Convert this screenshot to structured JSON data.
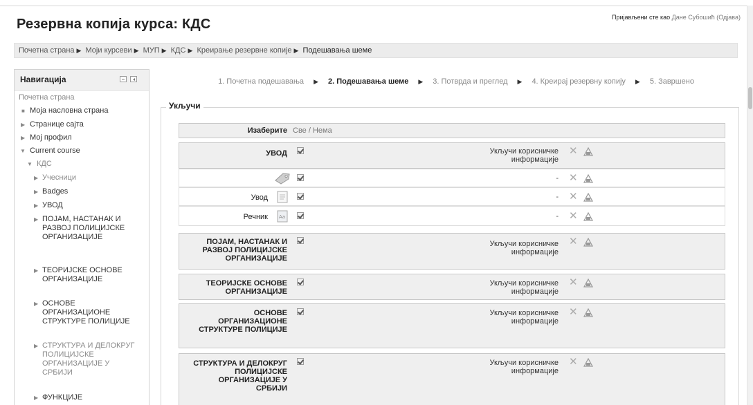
{
  "page": {
    "title": "Резервна копија курса: КДС",
    "login": {
      "prefix": "Пријављени сте као",
      "user": "Дане Субошић",
      "logout": "(Одјава)"
    }
  },
  "breadcrumb": {
    "items": [
      "Почетна страна",
      "Моји курсеви",
      "МУП",
      "КДС",
      "Креирање резервне копије",
      "Подешавања шеме"
    ]
  },
  "navigation": {
    "title": "Навигација",
    "home": "Почетна страна",
    "items": [
      "Моја насловна страна",
      "Странице сајта",
      "Мој профил",
      "Current course",
      "КДС",
      "Учесници",
      "Badges",
      "УВОД"
    ],
    "topics": [
      "ПОЈАМ, НАСТАНАК И РАЗВОЈ ПОЛИЦИЈСКЕ ОРГАНИЗАЦИЈЕ",
      "ТЕОРИЈСКЕ ОСНОВЕ ОРГАНИЗАЦИЈЕ",
      "ОСНОВЕ ОРГАНИЗАЦИОНЕ СТРУКТУРЕ ПОЛИЦИЈЕ",
      "СТРУКТУРА И ДЕЛОКРУГ ПОЛИЦИЈСКЕ ОРГАНИЗАЦИЈЕ У СРБИЈИ",
      "ФУНКЦИЈЕ"
    ]
  },
  "steps": [
    "1. Почетна подешавања",
    "2. Подешавања шеме",
    "3. Потврда и преглед",
    "4. Креирај резервну копију",
    "5. Завршено"
  ],
  "schema": {
    "legend": "Укључи",
    "select_label": "Изаберите",
    "select_options": "Све / Нема",
    "include_user_info": "Укључи корисничке информације",
    "dash": "-",
    "sections": [
      {
        "title": "УВОД",
        "items": [
          "",
          "Увод",
          "Речник"
        ]
      },
      {
        "title": "ПОЈАМ, НАСТАНАК И РАЗВОЈ ПОЛИЦИЈСКЕ ОРГАНИЗАЦИЈЕ",
        "items": []
      },
      {
        "title": "ТЕОРИЈСКЕ ОСНОВЕ ОРГАНИЗАЦИЈЕ",
        "items": []
      },
      {
        "title": "ОСНОВЕ ОРГАНИЗАЦИОНЕ СТРУКТУРЕ ПОЛИЦИЈЕ",
        "items": []
      },
      {
        "title": "СТРУКТУРА И ДЕЛОКРУГ ПОЛИЦИЈСКЕ ОРГАНИЗАЦИЈЕ У СРБИЈИ",
        "items": []
      }
    ]
  },
  "icons": [
    "tag-icon",
    "page-icon",
    "glossary-icon",
    "delete-icon",
    "lock-icon",
    "checkbox-checked-icon"
  ]
}
